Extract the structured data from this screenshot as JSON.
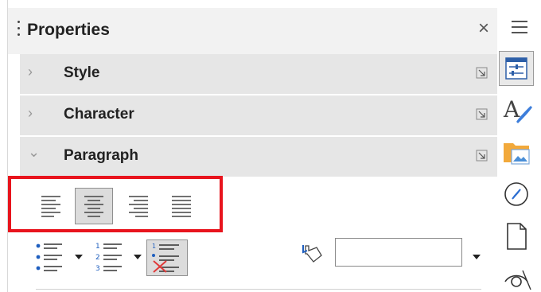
{
  "panel": {
    "title": "Properties",
    "close_symbol": "×"
  },
  "sections": [
    {
      "label": "Style",
      "state": "collapsed",
      "chevron": "›"
    },
    {
      "label": "Character",
      "state": "collapsed",
      "chevron": "›"
    },
    {
      "label": "Paragraph",
      "state": "expanded",
      "chevron": "⌄"
    }
  ],
  "paragraph": {
    "alignment_buttons": [
      {
        "icon": "align-left-icon",
        "active": false
      },
      {
        "icon": "align-center-icon",
        "active": true
      },
      {
        "icon": "align-right-icon",
        "active": false
      },
      {
        "icon": "align-justify-icon",
        "active": false
      }
    ],
    "list_buttons": [
      {
        "icon": "unordered-list-icon",
        "has_dropdown": true
      },
      {
        "icon": "ordered-list-icon",
        "has_dropdown": true
      },
      {
        "icon": "no-list-icon",
        "active": true,
        "has_dropdown": false
      }
    ],
    "background_color": {
      "icon": "paint-bucket-icon",
      "value": ""
    }
  },
  "sidebar_tabs": [
    {
      "icon": "properties-icon",
      "active": true
    },
    {
      "icon": "styles-icon",
      "active": false
    },
    {
      "icon": "gallery-icon",
      "active": false
    },
    {
      "icon": "navigator-icon",
      "active": false
    },
    {
      "icon": "page-icon",
      "active": false
    },
    {
      "icon": "inspector-icon",
      "active": false
    }
  ],
  "colors": {
    "highlight": "#e8141d",
    "section_bg": "#e6e6e6",
    "header_bg": "#f2f2f2"
  }
}
